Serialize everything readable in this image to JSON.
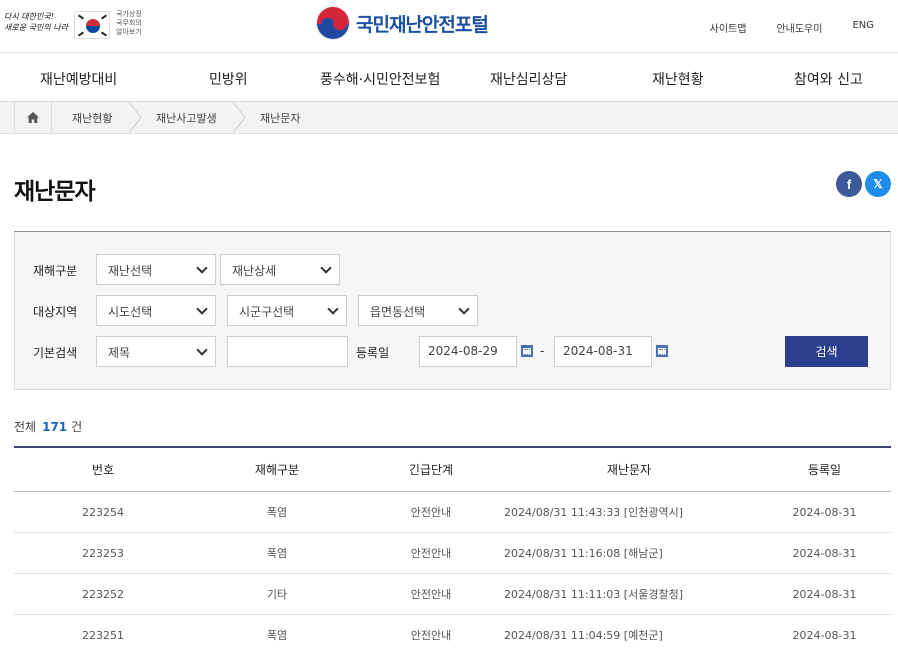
{
  "header": {
    "gov_slogan": "다시 대한민국!\n새로운 국민의 나라",
    "gov_text": "국가상징\n국무회의\n알아보기",
    "portal_name": "국민재난안전포털",
    "util_links": [
      "사이트맵",
      "안내도우미",
      "ENG"
    ]
  },
  "gnb": [
    "재난예방대비",
    "민방위",
    "풍수해·시민안전보험",
    "재난심리상담",
    "재난현황",
    "참여와 신고"
  ],
  "breadcrumb": [
    "재난현황",
    "재난사고발생",
    "재난문자"
  ],
  "page_title": "재난문자",
  "search": {
    "labels": {
      "type": "재해구분",
      "region": "대상지역",
      "basic": "기본검색",
      "date": "등록일"
    },
    "type_selects": [
      "재난선택",
      "재난상세"
    ],
    "region_selects": [
      "시도선택",
      "시군구선택",
      "읍면동선택"
    ],
    "basic_select": "제목",
    "keyword": "",
    "date_from": "2024-08-29",
    "date_sep": "-",
    "date_to": "2024-08-31",
    "button": "검색"
  },
  "total": {
    "prefix": "전체",
    "count": "171",
    "suffix": "건"
  },
  "table": {
    "headers": [
      "번호",
      "재해구분",
      "긴급단계",
      "재난문자",
      "등록일"
    ],
    "rows": [
      [
        "223254",
        "폭염",
        "안전안내",
        "2024/08/31 11:43:33 [인천광역시]",
        "2024-08-31"
      ],
      [
        "223253",
        "폭염",
        "안전안내",
        "2024/08/31 11:16:08 [해남군]",
        "2024-08-31"
      ],
      [
        "223252",
        "기타",
        "안전안내",
        "2024/08/31 11:11:03 [서울경찰청]",
        "2024-08-31"
      ],
      [
        "223251",
        "폭염",
        "안전안내",
        "2024/08/31 11:04:59 [예천군]",
        "2024-08-31"
      ]
    ]
  },
  "colors": {
    "accent": "#2c3f8f",
    "brand": "#1b4fa3",
    "count": "#1b64c0"
  }
}
